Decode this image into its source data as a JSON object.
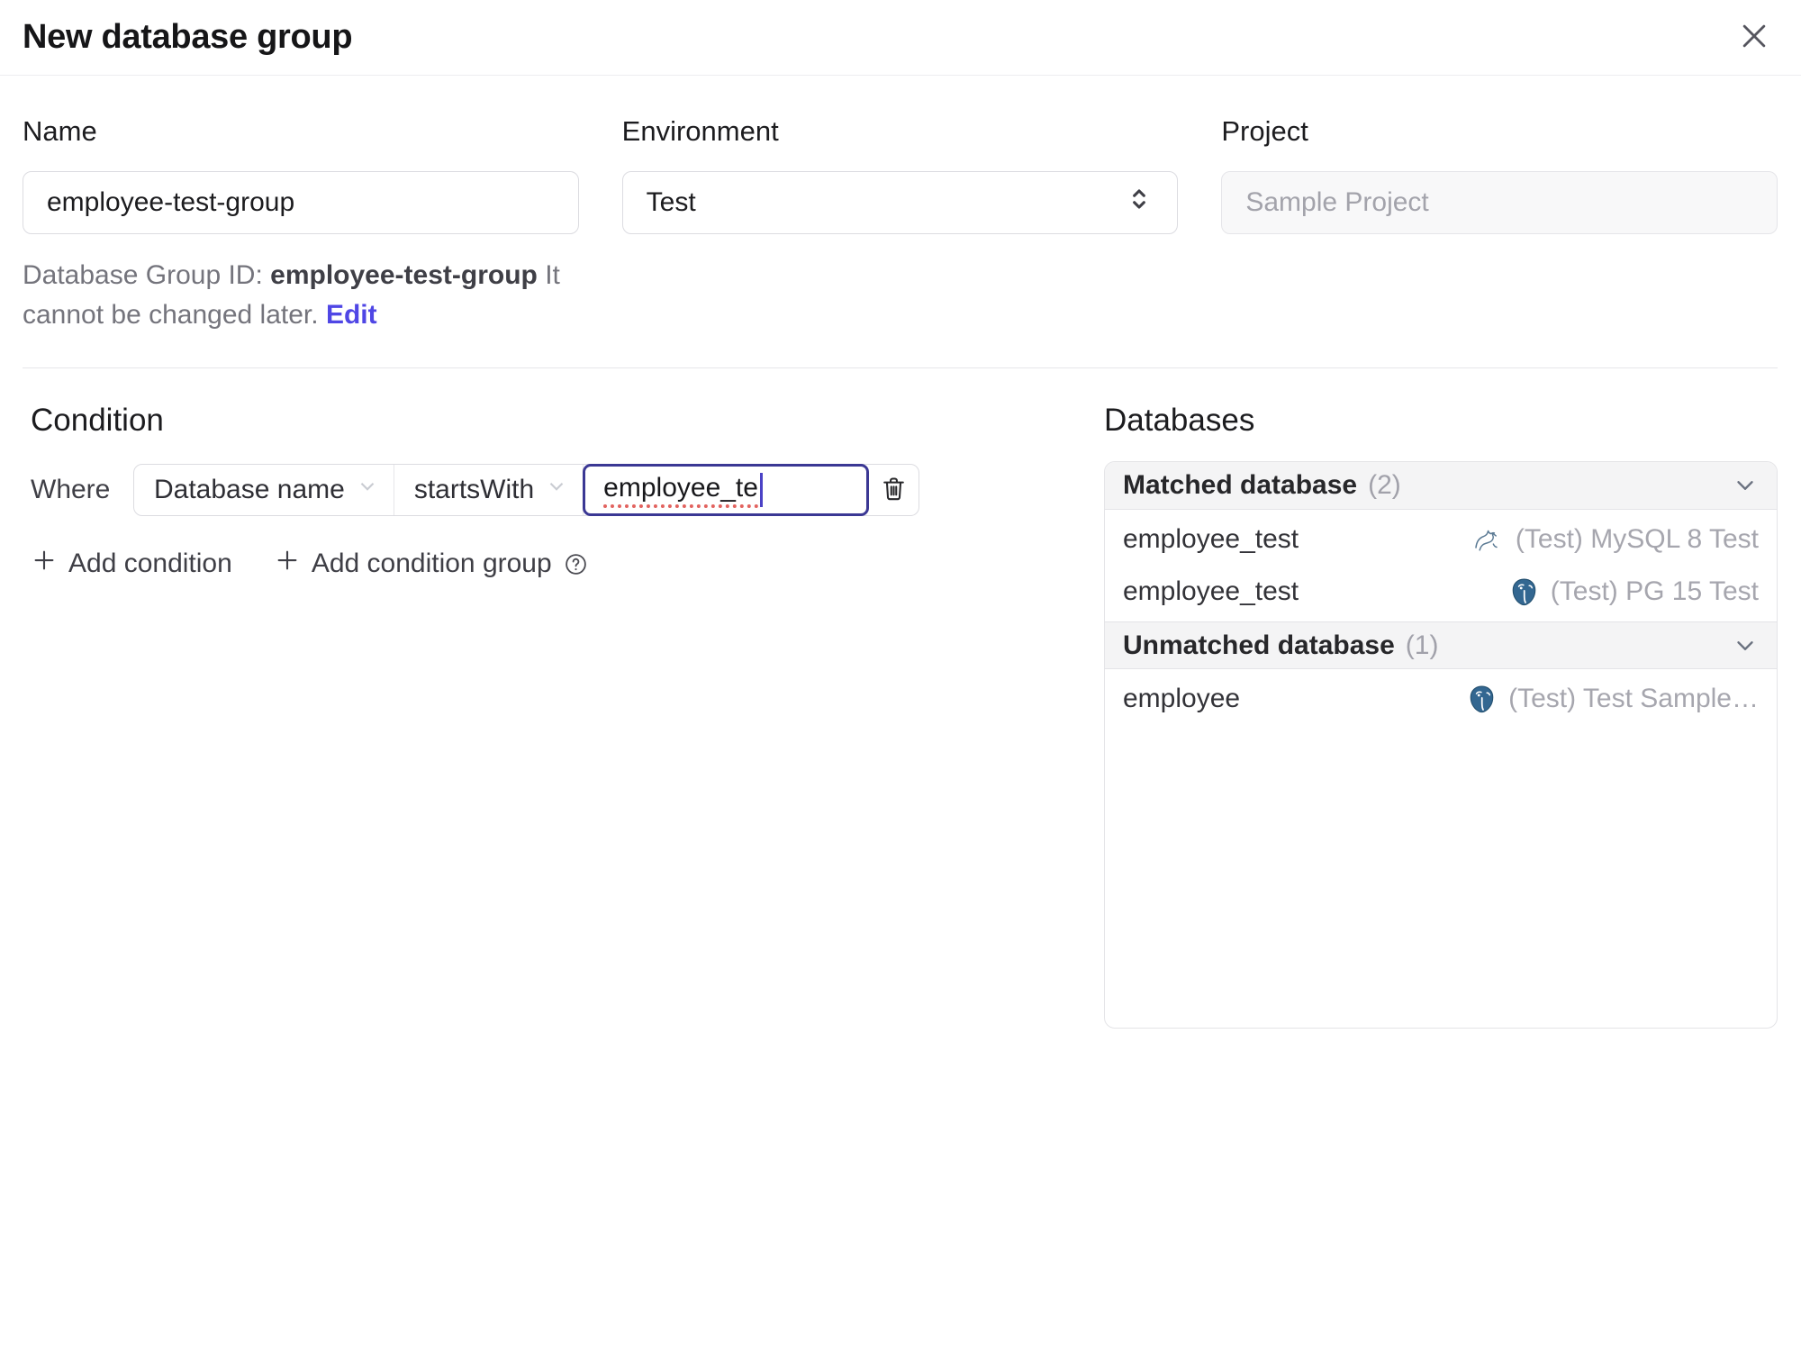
{
  "dialog": {
    "title": "New database group"
  },
  "form": {
    "name": {
      "label": "Name",
      "value": "employee-test-group"
    },
    "environment": {
      "label": "Environment",
      "value": "Test"
    },
    "project": {
      "label": "Project",
      "value": "Sample Project"
    },
    "id_note": {
      "prefix": "Database Group ID: ",
      "id": "employee-test-group",
      "suffix": " It cannot be changed later. ",
      "edit_label": "Edit"
    }
  },
  "condition": {
    "heading": "Condition",
    "where_label": "Where",
    "factor": "Database name",
    "operator": "startsWith",
    "value": "employee_te",
    "add_condition_label": "Add condition",
    "add_condition_group_label": "Add condition group"
  },
  "databases": {
    "heading": "Databases",
    "matched": {
      "title": "Matched database",
      "count": "(2)",
      "rows": [
        {
          "name": "employee_test",
          "engine": "mysql",
          "instance": "(Test) MySQL 8 Test"
        },
        {
          "name": "employee_test",
          "engine": "postgres",
          "instance": "(Test) PG 15 Test"
        }
      ]
    },
    "unmatched": {
      "title": "Unmatched database",
      "count": "(1)",
      "rows": [
        {
          "name": "employee",
          "engine": "postgres",
          "instance": "(Test) Test Sample…"
        }
      ]
    }
  },
  "colors": {
    "accent": "#4f46e5",
    "focus_border": "#3b3894",
    "spellcheck_underline": "#e2635f",
    "postgres_brand": "#336791",
    "mysql_brand": "#5b7a94",
    "panel_header_bg": "#f4f4f5",
    "muted_text": "#a1a1aa"
  }
}
